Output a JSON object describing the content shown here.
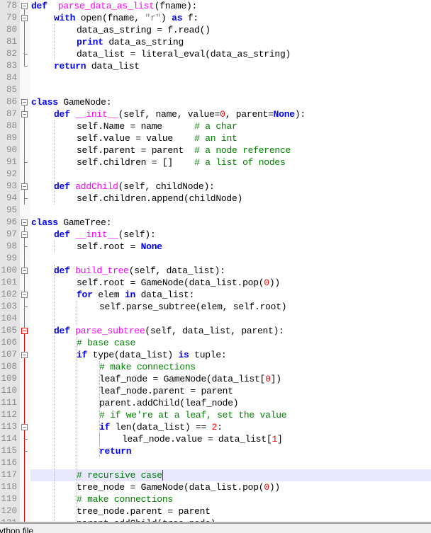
{
  "editor": {
    "first_line_number": 78,
    "current_line_number": 117,
    "lines": [
      {
        "n": "78",
        "tokens": [
          [
            "kw",
            "def"
          ],
          [
            "",
            "  "
          ],
          [
            "fn",
            "parse_data_as_list"
          ],
          [
            "",
            "(fname):"
          ]
        ],
        "indent": 0
      },
      {
        "n": "79",
        "tokens": [
          [
            "kw",
            "with"
          ],
          [
            "",
            " open(fname, "
          ],
          [
            "str",
            "\"r\""
          ],
          [
            "",
            ") "
          ],
          [
            "kw",
            "as"
          ],
          [
            "",
            " f:"
          ]
        ],
        "indent": 1
      },
      {
        "n": "80",
        "tokens": [
          [
            "",
            "data_as_string = f.read()"
          ]
        ],
        "indent": 2
      },
      {
        "n": "81",
        "tokens": [
          [
            "kw",
            "print"
          ],
          [
            "",
            " data_as_string"
          ]
        ],
        "indent": 2
      },
      {
        "n": "82",
        "tokens": [
          [
            "",
            "data_list = literal_eval(data_as_string)"
          ]
        ],
        "indent": 2
      },
      {
        "n": "83",
        "tokens": [
          [
            "kw",
            "return"
          ],
          [
            "",
            " data_list"
          ]
        ],
        "indent": 1
      },
      {
        "n": "84",
        "tokens": [],
        "indent": 0
      },
      {
        "n": "85",
        "tokens": [],
        "indent": 0
      },
      {
        "n": "86",
        "tokens": [
          [
            "kw",
            "class"
          ],
          [
            "",
            " GameNode:"
          ]
        ],
        "indent": 0
      },
      {
        "n": "87",
        "tokens": [
          [
            "kw",
            "def"
          ],
          [
            "",
            " "
          ],
          [
            "fn",
            "__init__"
          ],
          [
            "",
            "(self, name, value="
          ],
          [
            "num",
            "0"
          ],
          [
            "",
            ", parent="
          ],
          [
            "kw",
            "None"
          ],
          [
            "",
            "):"
          ]
        ],
        "indent": 1
      },
      {
        "n": "88",
        "tokens": [
          [
            "",
            "self.Name = name      "
          ],
          [
            "cm",
            "# a char"
          ]
        ],
        "indent": 2
      },
      {
        "n": "89",
        "tokens": [
          [
            "",
            "self.value = value    "
          ],
          [
            "cm",
            "# an int"
          ]
        ],
        "indent": 2
      },
      {
        "n": "90",
        "tokens": [
          [
            "",
            "self.parent = parent  "
          ],
          [
            "cm",
            "# a node reference"
          ]
        ],
        "indent": 2
      },
      {
        "n": "91",
        "tokens": [
          [
            "",
            "self.children = []    "
          ],
          [
            "cm",
            "# a list of nodes"
          ]
        ],
        "indent": 2
      },
      {
        "n": "92",
        "tokens": [],
        "indent": 0
      },
      {
        "n": "93",
        "tokens": [
          [
            "kw",
            "def"
          ],
          [
            "",
            " "
          ],
          [
            "fn",
            "addChild"
          ],
          [
            "",
            "(self, childNode):"
          ]
        ],
        "indent": 1
      },
      {
        "n": "94",
        "tokens": [
          [
            "",
            "self.children.append(childNode)"
          ]
        ],
        "indent": 2
      },
      {
        "n": "95",
        "tokens": [],
        "indent": 0
      },
      {
        "n": "96",
        "tokens": [
          [
            "kw",
            "class"
          ],
          [
            "",
            " GameTree:"
          ]
        ],
        "indent": 0
      },
      {
        "n": "97",
        "tokens": [
          [
            "kw",
            "def"
          ],
          [
            "",
            " "
          ],
          [
            "fn",
            "__init__"
          ],
          [
            "",
            "(self):"
          ]
        ],
        "indent": 1
      },
      {
        "n": "98",
        "tokens": [
          [
            "",
            "self.root = "
          ],
          [
            "kw",
            "None"
          ]
        ],
        "indent": 2
      },
      {
        "n": "99",
        "tokens": [],
        "indent": 0
      },
      {
        "n": "100",
        "tokens": [
          [
            "kw",
            "def"
          ],
          [
            "",
            " "
          ],
          [
            "fn",
            "build_tree"
          ],
          [
            "",
            "(self, data_list):"
          ]
        ],
        "indent": 1
      },
      {
        "n": "101",
        "tokens": [
          [
            "",
            "self.root = GameNode(data_list.pop("
          ],
          [
            "num",
            "0"
          ],
          [
            "",
            "))"
          ]
        ],
        "indent": 2
      },
      {
        "n": "102",
        "tokens": [
          [
            "kw",
            "for"
          ],
          [
            "",
            " elem "
          ],
          [
            "kw",
            "in"
          ],
          [
            "",
            " data_list:"
          ]
        ],
        "indent": 2
      },
      {
        "n": "103",
        "tokens": [
          [
            "",
            "self.parse_subtree(elem, self.root)"
          ]
        ],
        "indent": 3
      },
      {
        "n": "104",
        "tokens": [],
        "indent": 0
      },
      {
        "n": "105",
        "tokens": [
          [
            "kw",
            "def"
          ],
          [
            "",
            " "
          ],
          [
            "fn",
            "parse_subtree"
          ],
          [
            "",
            "(self, data_list, parent):"
          ]
        ],
        "indent": 1
      },
      {
        "n": "106",
        "tokens": [
          [
            "cm",
            "# base case"
          ]
        ],
        "indent": 2
      },
      {
        "n": "107",
        "tokens": [
          [
            "kw",
            "if"
          ],
          [
            "",
            " type(data_list) "
          ],
          [
            "kw",
            "is"
          ],
          [
            "",
            " tuple:"
          ]
        ],
        "indent": 2
      },
      {
        "n": "108",
        "tokens": [
          [
            "cm",
            "# make connections"
          ]
        ],
        "indent": 3
      },
      {
        "n": "109",
        "tokens": [
          [
            "",
            "leaf_node = GameNode(data_list["
          ],
          [
            "num",
            "0"
          ],
          [
            "",
            "])"
          ]
        ],
        "indent": 3
      },
      {
        "n": "110",
        "tokens": [
          [
            "",
            "leaf_node.parent = parent"
          ]
        ],
        "indent": 3
      },
      {
        "n": "111",
        "tokens": [
          [
            "",
            "parent.addChild(leaf_node)"
          ]
        ],
        "indent": 3
      },
      {
        "n": "112",
        "tokens": [
          [
            "cm",
            "# if we're at a leaf, set the value"
          ]
        ],
        "indent": 3
      },
      {
        "n": "113",
        "tokens": [
          [
            "kw",
            "if"
          ],
          [
            "",
            " len(data_list) == "
          ],
          [
            "num",
            "2"
          ],
          [
            "",
            ":"
          ]
        ],
        "indent": 3
      },
      {
        "n": "114",
        "tokens": [
          [
            "",
            "leaf_node.value = data_list["
          ],
          [
            "num",
            "1"
          ],
          [
            "",
            "]"
          ]
        ],
        "indent": 4
      },
      {
        "n": "115",
        "tokens": [
          [
            "kw",
            "return"
          ]
        ],
        "indent": 3
      },
      {
        "n": "116",
        "tokens": [],
        "indent": 0
      },
      {
        "n": "117",
        "tokens": [
          [
            "cm",
            "# recursive case"
          ]
        ],
        "indent": 2
      },
      {
        "n": "118",
        "tokens": [
          [
            "",
            "tree_node = GameNode(data_list.pop("
          ],
          [
            "num",
            "0"
          ],
          [
            "",
            "))"
          ]
        ],
        "indent": 2
      },
      {
        "n": "119",
        "tokens": [
          [
            "cm",
            "# make connections"
          ]
        ],
        "indent": 2
      },
      {
        "n": "120",
        "tokens": [
          [
            "",
            "tree_node.parent = parent"
          ]
        ],
        "indent": 2
      },
      {
        "n": "121",
        "tokens": [
          [
            "",
            "parent.addChild(tree_node)"
          ]
        ],
        "indent": 2
      }
    ]
  },
  "statusbar": {
    "text": "Python file"
  },
  "colors": {
    "keyword": "#0000ff",
    "function_name": "#ff00ff",
    "number": "#ff0000",
    "string": "#808080",
    "comment": "#008000",
    "current_line": "#e8e8ff",
    "active_fold": "#ff0000"
  }
}
